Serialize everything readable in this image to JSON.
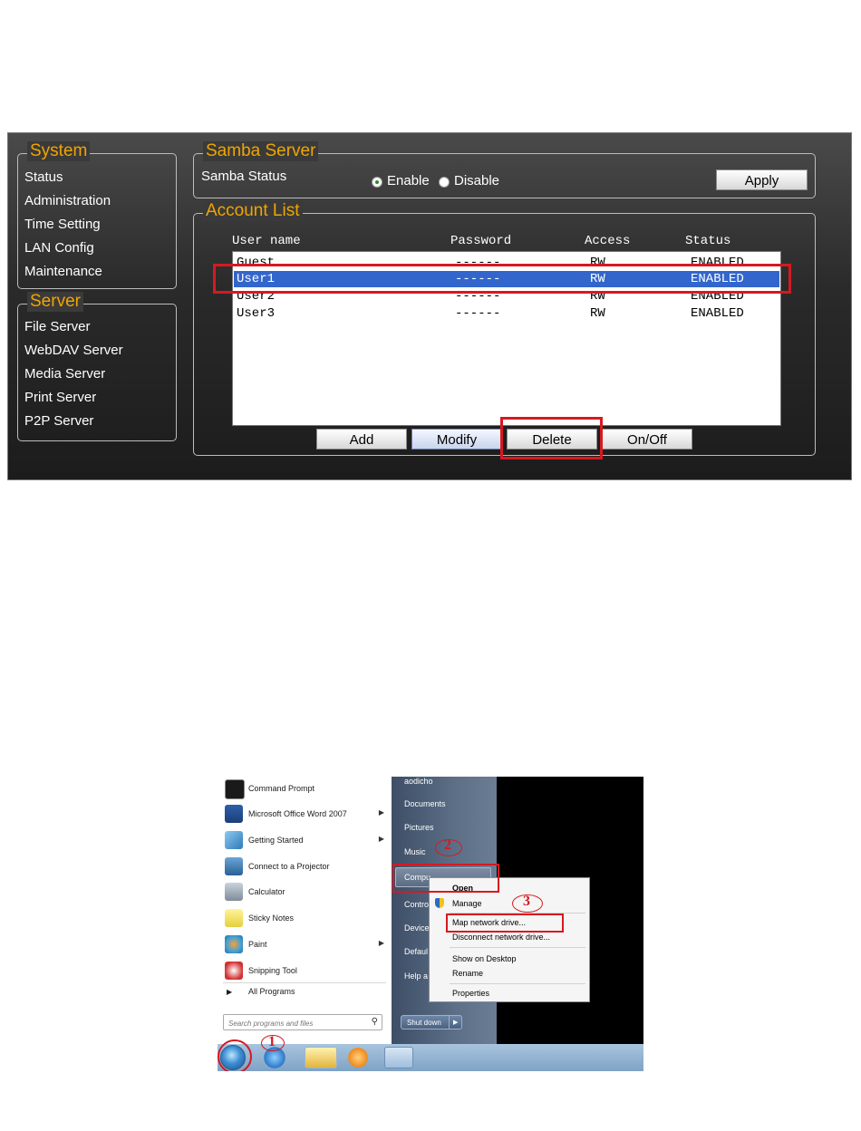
{
  "system": {
    "legend": "System",
    "items": [
      "Status",
      "Administration",
      "Time Setting",
      "LAN Config",
      "Maintenance"
    ]
  },
  "server": {
    "legend": "Server",
    "items": [
      "File Server",
      "WebDAV Server",
      "Media Server",
      "Print Server",
      "P2P Server"
    ]
  },
  "samba": {
    "legend": "Samba Server",
    "status_label": "Samba Status",
    "enable_label": "Enable",
    "disable_label": "Disable",
    "selected": "Enable",
    "apply_label": "Apply"
  },
  "account_list": {
    "legend": "Account List",
    "columns": [
      "User name",
      "Password",
      "Access",
      "Status"
    ],
    "rows": [
      {
        "user": "Guest",
        "password": "------",
        "access": "RW",
        "status": "ENABLED"
      },
      {
        "user": "User1",
        "password": "------",
        "access": "RW",
        "status": "ENABLED"
      },
      {
        "user": "User2",
        "password": "------",
        "access": "RW",
        "status": "ENABLED"
      },
      {
        "user": "User3",
        "password": "------",
        "access": "RW",
        "status": "ENABLED"
      }
    ],
    "selected_row": 1,
    "buttons": [
      "Add",
      "Modify",
      "Delete",
      "On/Off"
    ]
  },
  "start_menu": {
    "left_items": [
      {
        "label": "Command Prompt",
        "icon": "command-prompt-icon",
        "submenu": false
      },
      {
        "label": "Microsoft Office Word 2007",
        "icon": "word-icon",
        "submenu": true
      },
      {
        "label": "Getting Started",
        "icon": "getting-started-icon",
        "submenu": true
      },
      {
        "label": "Connect to a Projector",
        "icon": "projector-icon",
        "submenu": false
      },
      {
        "label": "Calculator",
        "icon": "calculator-icon",
        "submenu": false
      },
      {
        "label": "Sticky Notes",
        "icon": "sticky-notes-icon",
        "submenu": false
      },
      {
        "label": "Paint",
        "icon": "paint-icon",
        "submenu": true
      },
      {
        "label": "Snipping Tool",
        "icon": "snipping-tool-icon",
        "submenu": false
      }
    ],
    "all_programs": "All Programs",
    "search_placeholder": "Search programs and files",
    "right_items": [
      "aodicho",
      "Documents",
      "Pictures",
      "Music",
      "Compu",
      "Contro",
      "Device",
      "Defaul",
      "Help a"
    ],
    "shutdown_label": "Shut down"
  },
  "context_menu": {
    "items": [
      "Open",
      "Manage",
      "Map network drive...",
      "Disconnect network drive...",
      "Show on Desktop",
      "Rename",
      "Properties"
    ]
  },
  "annotations": [
    "1",
    "2",
    "3"
  ],
  "colors": {
    "legend_orange": "#f0a500",
    "highlight_red": "#d71920",
    "selection_blue": "#3366cc"
  }
}
